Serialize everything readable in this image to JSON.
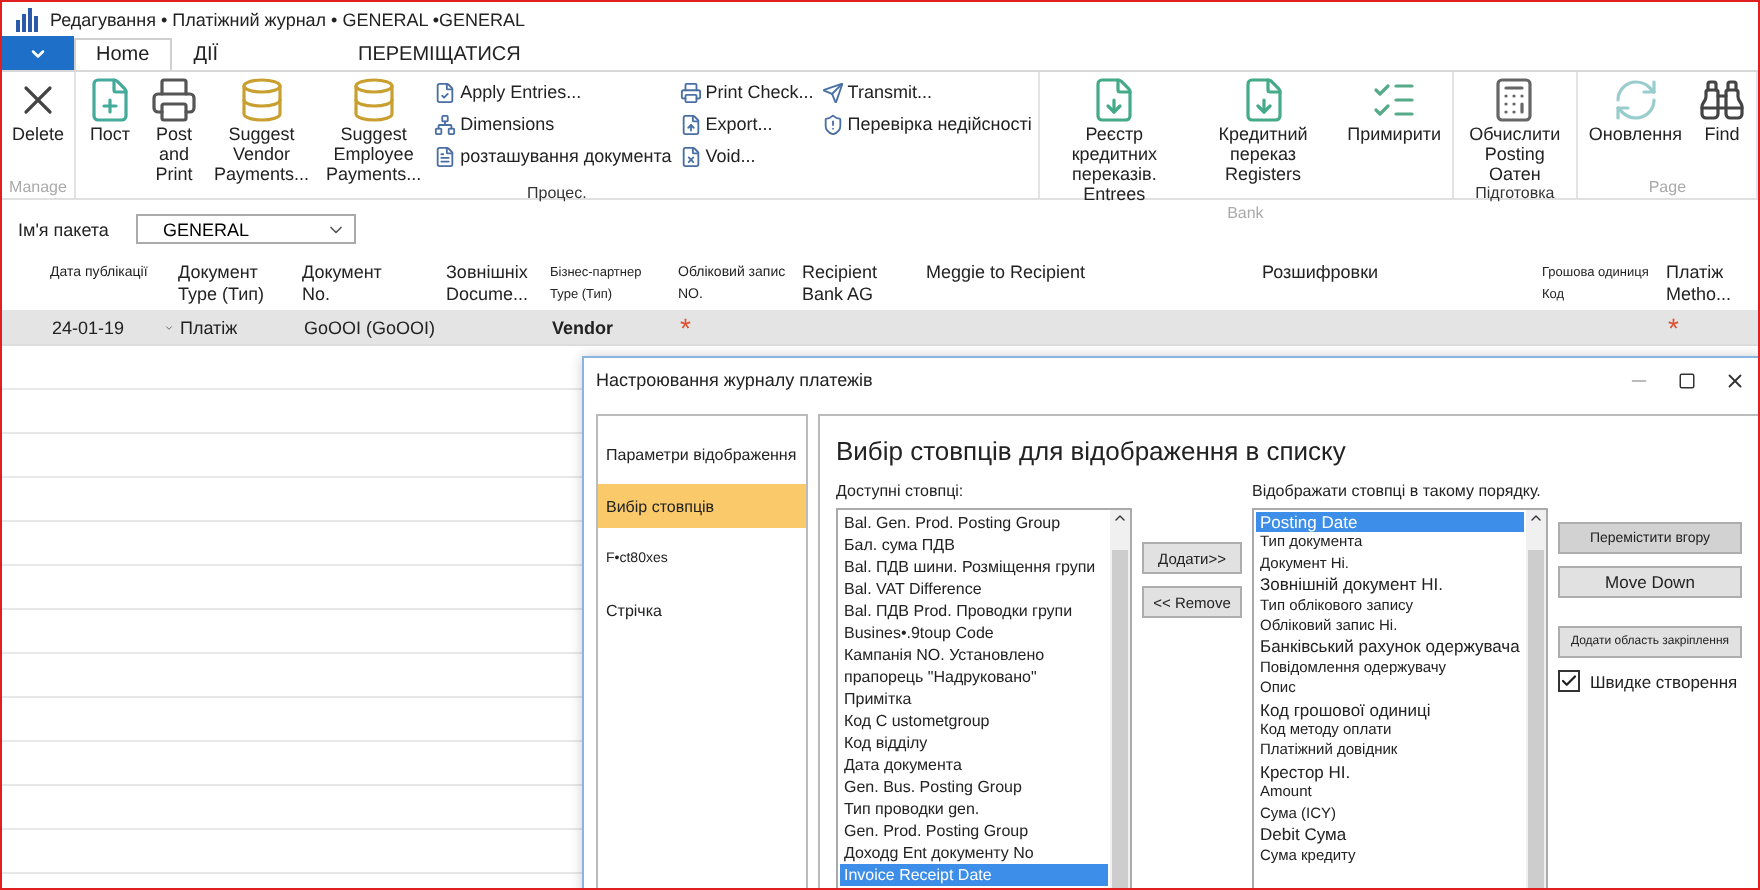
{
  "window": {
    "title": "Редагування • Платіжний журнал • GENERAL •GENERAL"
  },
  "ribbon_tabs": [
    {
      "label": "Home",
      "selected": true
    },
    {
      "label": "ДІЇ",
      "selected": false
    },
    {
      "label": "ПЕРЕМІЩАТИСЯ",
      "selected": false
    }
  ],
  "ribbon_groups": [
    {
      "label": "Manage",
      "disabled": true,
      "items": [
        {
          "kind": "large",
          "label": "Delete"
        }
      ]
    },
    {
      "label": "Процес.",
      "disabled": false,
      "items": [
        {
          "kind": "large",
          "label": "Пост"
        },
        {
          "kind": "large",
          "label": "Post and\nPrint"
        },
        {
          "kind": "large",
          "label": "Suggest Vendor\nPayments..."
        },
        {
          "kind": "large",
          "label": "Suggest Employee\nPayments..."
        },
        {
          "kind": "stack",
          "entries": [
            "Apply Entries...",
            "Dimensions",
            "розташування документа"
          ]
        },
        {
          "kind": "stack",
          "entries": [
            "Print Check...",
            "Export...",
            "Void..."
          ]
        },
        {
          "kind": "stack",
          "entries": [
            "Transmit...",
            "Перевірка недійсності"
          ]
        }
      ]
    },
    {
      "label": "Bank",
      "disabled": true,
      "items": [
        {
          "kind": "large",
          "label": "Реєстр кредитних\nпереказів. Entrees"
        },
        {
          "kind": "large",
          "label": "Кредитний переказ\nRegisters"
        },
        {
          "kind": "large",
          "label": "Примирити"
        }
      ]
    },
    {
      "label": "Підготовка",
      "disabled": false,
      "items": [
        {
          "kind": "large",
          "label": "Обчислити\nPosting Оатен"
        }
      ]
    },
    {
      "label": "Page",
      "disabled": true,
      "items": [
        {
          "kind": "large",
          "label": "Оновлення"
        },
        {
          "kind": "large",
          "label": "Find"
        }
      ]
    }
  ],
  "batch": {
    "label": "Ім'я пакета",
    "value": "GENERAL"
  },
  "table": {
    "columns": [
      "Дата публікації",
      "Документ\nType (Тип)",
      "Документ\nNo.",
      "Зовнішніх\nDocume...",
      "Бізнес-партнер\nType (Тип)",
      "Обліковий запис NO.",
      "Recipient\nBank AG",
      "Meggie to Recipient",
      "Розшифровки",
      "Грошова одиниця\nКод",
      "Платіж\nMetho..."
    ],
    "rows": [
      {
        "selected": true,
        "cells": [
          "24-01-19",
          "Платіж",
          "GoOOI (GoOOI)",
          "",
          "Vendor",
          "*",
          "",
          "",
          "",
          "",
          "*"
        ]
      }
    ]
  },
  "dialog": {
    "title": "Настроювання журналу платежів",
    "nav": [
      {
        "label": "Параметри відображення",
        "selected": false
      },
      {
        "label": "Вибір стовпців",
        "selected": true
      },
      {
        "label": "F•ct80xes",
        "selected": false
      },
      {
        "label": "Стрічка",
        "selected": false
      }
    ],
    "heading": "Вибір стовпців для відображення в списку",
    "available_label": "Доступні стовпці:",
    "available": [
      {
        "label": "Bal. Gen. Prod. Posting Group",
        "selected": false
      },
      {
        "label": "Бал. сума ПДВ",
        "selected": false
      },
      {
        "label": "Bal. ПДВ шини. Розміщення групи",
        "selected": false
      },
      {
        "label": "Bal. VAT Difference",
        "selected": false
      },
      {
        "label": "Bal. ПДВ Prod. Проводки групи",
        "selected": false
      },
      {
        "label": "Busines•.9toup Code",
        "selected": false
      },
      {
        "label": "Кампанія NO. Установлено",
        "selected": false
      },
      {
        "label": "прапорець \"Надруковано\"",
        "selected": false
      },
      {
        "label": "Примітка",
        "selected": false
      },
      {
        "label": "Код C ustometgroup",
        "selected": false
      },
      {
        "label": "Код відділу",
        "selected": false
      },
      {
        "label": "Дата документа",
        "selected": false
      },
      {
        "label": "Gen. Bus. Posting Group",
        "selected": false
      },
      {
        "label": "Тип проводки gen.",
        "selected": false
      },
      {
        "label": "Gen. Prod. Posting Group",
        "selected": false
      },
      {
        "label": "Доходg Ent документу No",
        "selected": false
      },
      {
        "label": "Invoice Receipt Date",
        "selected": true
      }
    ],
    "add_button": "Додати>>",
    "remove_button": "<< Remove",
    "shown_label": "Відображати стовпці в такому порядку.",
    "shown": [
      {
        "label": "Posting Date",
        "selected": true
      },
      {
        "label": "Тип документа",
        "selected": false
      },
      {
        "label": "Документ Hi.",
        "selected": false
      },
      {
        "label": "Зовнішній документ HI.",
        "selected": false
      },
      {
        "label": "Тип облікового запису",
        "selected": false
      },
      {
        "label": "Обліковий запис Hi.",
        "selected": false
      },
      {
        "label": "Банківський рахунок одержувача",
        "selected": false
      },
      {
        "label": "Повідомлення одержувачу",
        "selected": false
      },
      {
        "label": "Опис",
        "selected": false
      },
      {
        "label": "Код грошової одиниці",
        "selected": false
      },
      {
        "label": "Код методу оплати",
        "selected": false
      },
      {
        "label": "Платіжний довідник",
        "selected": false
      },
      {
        "label": "Крестор HI.",
        "selected": false
      },
      {
        "label": "Amount",
        "selected": false
      },
      {
        "label": "Сума (ICY)",
        "selected": false
      },
      {
        "label": "Debit Сума",
        "selected": false
      },
      {
        "label": "Сума кредиту",
        "selected": false
      }
    ],
    "move_up": "Перемістити вгору",
    "move_down": "Move Down",
    "add_freeze": "Додати область закріплення",
    "quick_create": {
      "label": "Швидке створення",
      "checked": true
    }
  }
}
